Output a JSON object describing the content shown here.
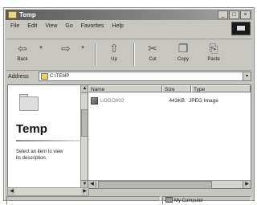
{
  "window": {
    "title": "Temp"
  },
  "menu": [
    "File",
    "Edit",
    "View",
    "Go",
    "Favorites",
    "Help"
  ],
  "toolbar": [
    {
      "label": "Back",
      "icon": "back-arrow-icon"
    },
    {
      "label": "",
      "icon": "forward-arrow-icon"
    },
    {
      "label": "",
      "icon": "up-icon"
    },
    {
      "label": "Up",
      "icon": "up-folder-icon"
    },
    {
      "label": "Cut",
      "icon": "scissors-icon"
    },
    {
      "label": "Copy",
      "icon": "copy-icon"
    },
    {
      "label": "Paste",
      "icon": "paste-icon"
    }
  ],
  "address": {
    "label": "Address",
    "value": "C:\\TEMP"
  },
  "left_panel": {
    "folder_title": "Temp",
    "description": "Select an item to view its description."
  },
  "list": {
    "columns": [
      "Name",
      "Size",
      "Type"
    ],
    "rows": [
      {
        "name": "LOGO002",
        "size": "443KB",
        "type": "JPEG Image"
      }
    ]
  },
  "status": {
    "zone": "My Computer"
  }
}
